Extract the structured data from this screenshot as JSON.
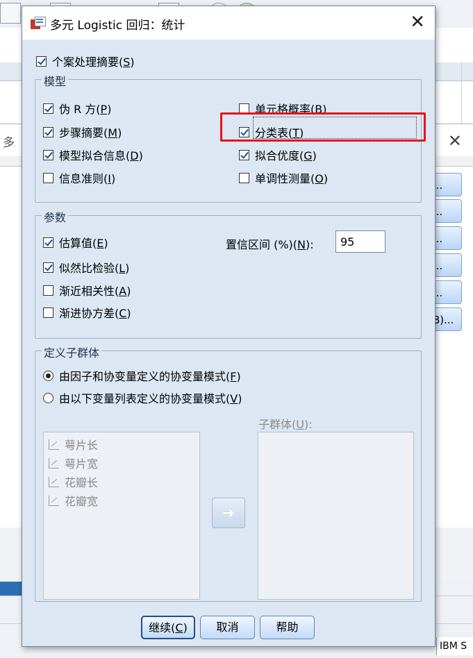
{
  "dialog": {
    "title": "多元 Logistic 回归：统计",
    "case_summary": {
      "label": "个案处理摘要(",
      "mn": "S",
      "tail": ")",
      "checked": true
    },
    "model_group": {
      "title": "模型",
      "items": [
        {
          "label": "伪 R 方(",
          "mn": "P",
          "tail": ")",
          "checked": true
        },
        {
          "label": "步骤摘要(",
          "mn": "M",
          "tail": ")",
          "checked": true
        },
        {
          "label": "模型拟合信息(",
          "mn": "D",
          "tail": ")",
          "checked": true
        },
        {
          "label": "信息准则(",
          "mn": "I",
          "tail": ")",
          "checked": false
        },
        {
          "label": "单元格概率(",
          "mn": "B",
          "tail": ")",
          "checked": false
        },
        {
          "label": "分类表(",
          "mn": "T",
          "tail": ")",
          "checked": true
        },
        {
          "label": "拟合优度(",
          "mn": "G",
          "tail": ")",
          "checked": true
        },
        {
          "label": "单调性测量(",
          "mn": "O",
          "tail": ")",
          "checked": false
        }
      ]
    },
    "params_group": {
      "title": "参数",
      "items": [
        {
          "label": "估算值(",
          "mn": "E",
          "tail": ")",
          "checked": true
        },
        {
          "label": "似然比检验(",
          "mn": "L",
          "tail": ")",
          "checked": true
        },
        {
          "label": "渐近相关性(",
          "mn": "A",
          "tail": ")",
          "checked": false
        },
        {
          "label": "渐进协方差(",
          "mn": "C",
          "tail": ")",
          "checked": false
        }
      ],
      "ci": {
        "label": "置信区间 (%)(",
        "mn": "N",
        "tail": "):",
        "value": "95"
      }
    },
    "subpop_group": {
      "title": "定义子群体",
      "radios": [
        {
          "label": "由因子和协变量定义的协变量模式(",
          "mn": "F",
          "tail": ")",
          "selected": true
        },
        {
          "label": "由以下变量列表定义的协变量模式(",
          "mn": "V",
          "tail": ")",
          "selected": false
        }
      ],
      "variables": [
        "萼片长",
        "萼片宽",
        "花瓣长",
        "花瓣宽"
      ],
      "subpop_label": {
        "label": "子群体(",
        "mn": "U",
        "tail": "):"
      }
    },
    "buttons": {
      "continue": {
        "label": "继续(",
        "mn": "C",
        "tail": ")"
      },
      "cancel": "取消",
      "help": "帮助"
    },
    "highlight_color": "#e8121b"
  },
  "background": {
    "side_buttons": [
      "...",
      "...",
      "...",
      "...",
      "...",
      "B)..."
    ],
    "partial_title": "多",
    "status": "IBM S"
  }
}
